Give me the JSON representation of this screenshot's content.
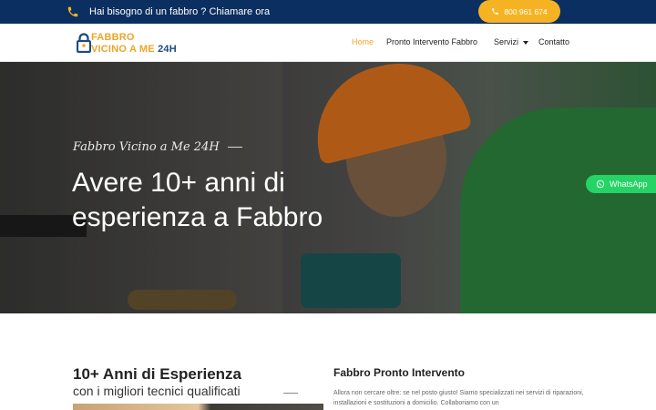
{
  "topbar": {
    "text": "Hai bisogno di un fabbro ? Chiamare ora",
    "phone_number": "800 961 674",
    "bg_color": "#0b2f60",
    "button_color": "#f5b324"
  },
  "logo": {
    "line1": "FABBRO",
    "line2": "VICINO A ME",
    "suffix": "24H",
    "color_main": "#e9a72a",
    "color_accent": "#1e4a7e"
  },
  "nav": {
    "items": [
      {
        "label": "Home",
        "active": true
      },
      {
        "label": "Pronto Intervento Fabbro"
      },
      {
        "label": "Servizi",
        "dropdown": true
      },
      {
        "label": "Contatto"
      }
    ]
  },
  "hero": {
    "tagline": "Fabbro Vicino a Me 24H",
    "headline_line1": "Avere 10+ anni di",
    "headline_line2": "esperienza a Fabbro"
  },
  "whatsapp": {
    "label": "WhatsApp",
    "color": "#25d366"
  },
  "experience": {
    "title": "10+ Anni di Esperienza",
    "subtitle": "con i migliori tecnici qualificati"
  },
  "pronto": {
    "title": "Fabbro Pronto Intervento",
    "text": "Allora non cercare oltre: se nel posto giusto! Siamo specializzati nei servizi di riparazioni, installazioni e sostituzioni a domicilio. Collaboriamo con un"
  }
}
